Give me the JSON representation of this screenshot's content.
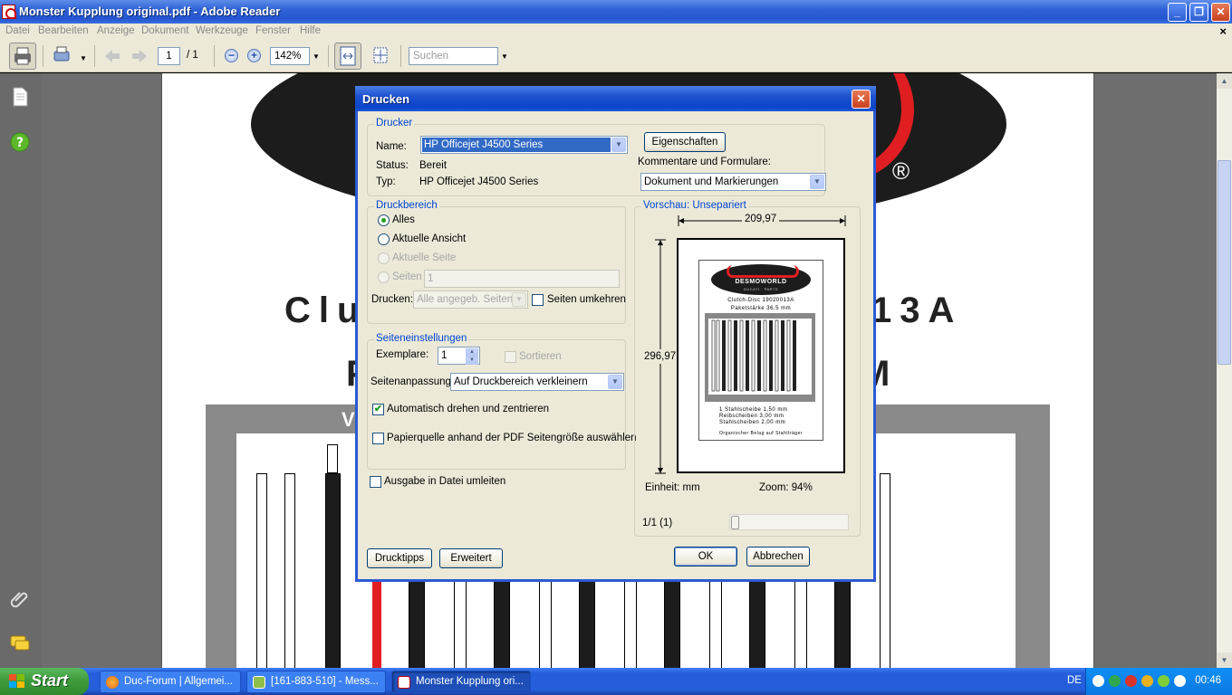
{
  "window": {
    "title": "Monster Kupplung original.pdf - Adobe Reader"
  },
  "menu": [
    "Datei",
    "Bearbeiten",
    "Anzeige",
    "Dokument",
    "Werkzeuge",
    "Fenster",
    "Hilfe"
  ],
  "toolbar": {
    "page_current": "1",
    "page_total": "/ 1",
    "zoom": "142%",
    "search_placeholder": "Suchen"
  },
  "document": {
    "logo_reg": "®",
    "line1_left": "Clu",
    "line1_right": "13A",
    "line2_left": "P",
    "line2_right": "M",
    "grey_text": "V"
  },
  "dialog": {
    "title": "Drucken",
    "printer_group": "Drucker",
    "name_label": "Name:",
    "printer_name": "HP Officejet J4500 Series",
    "properties_button": "Eigenschaften",
    "status_label": "Status:",
    "status_value": "Bereit",
    "type_label": "Typ:",
    "type_value": "HP Officejet J4500 Series",
    "comments_label": "Kommentare und Formulare:",
    "comments_value": "Dokument und Markierungen",
    "range_group": "Druckbereich",
    "range_all": "Alles",
    "range_view": "Aktuelle Ansicht",
    "range_page": "Aktuelle Seite",
    "range_pages": "Seiten",
    "range_pages_value": "1",
    "print_label": "Drucken:",
    "print_value": "Alle angegeb. Seiten",
    "reverse_label": "Seiten umkehren",
    "page_group": "Seiteneinstellungen",
    "copies_label": "Exemplare:",
    "copies_value": "1",
    "collate_label": "Sortieren",
    "scaling_label": "Seitenanpassung:",
    "scaling_value": "Auf Druckbereich verkleinern",
    "autorotate_label": "Automatisch drehen und zentrieren",
    "autorotate_checked": true,
    "papersource_label": "Papierquelle anhand der PDF Seitengröße auswählen",
    "tofile_label": "Ausgabe in Datei umleiten",
    "preview_group": "Vorschau: Unsepariert",
    "preview_width": "209,97",
    "preview_height": "296,97",
    "unit_label": "Einheit: mm",
    "zoom_label": "Zoom:  94%",
    "page_counter": "1/1 (1)",
    "tips_button": "Drucktipps",
    "advanced_button": "Erweitert",
    "ok_button": "OK",
    "cancel_button": "Abbrechen",
    "preview_texts": {
      "brand": "DESMOWORLD",
      "sub": "DUCATI · PARTS",
      "disc": "Clutch-Disc 19020013A",
      "thick": "Paketstärke 36,5 mm",
      "steel1": "1 Stahlscheibe 1,50 mm",
      "steel2": "Reibscheiben 3,00 mm",
      "steel3": "Stahlscheiben 2,00 mm",
      "bottom": "Organischer Belag auf Stahlträger"
    }
  },
  "taskbar": {
    "start": "Start",
    "tasks": [
      "Duc-Forum | Allgemei...",
      "[161-883-510] - Mess...",
      "Monster Kupplung ori..."
    ],
    "lang": "DE",
    "clock": "00:46"
  },
  "colors": {
    "accent": "#316ac5",
    "xp_blue": "#245edb",
    "logo_red": "#e01e22"
  }
}
